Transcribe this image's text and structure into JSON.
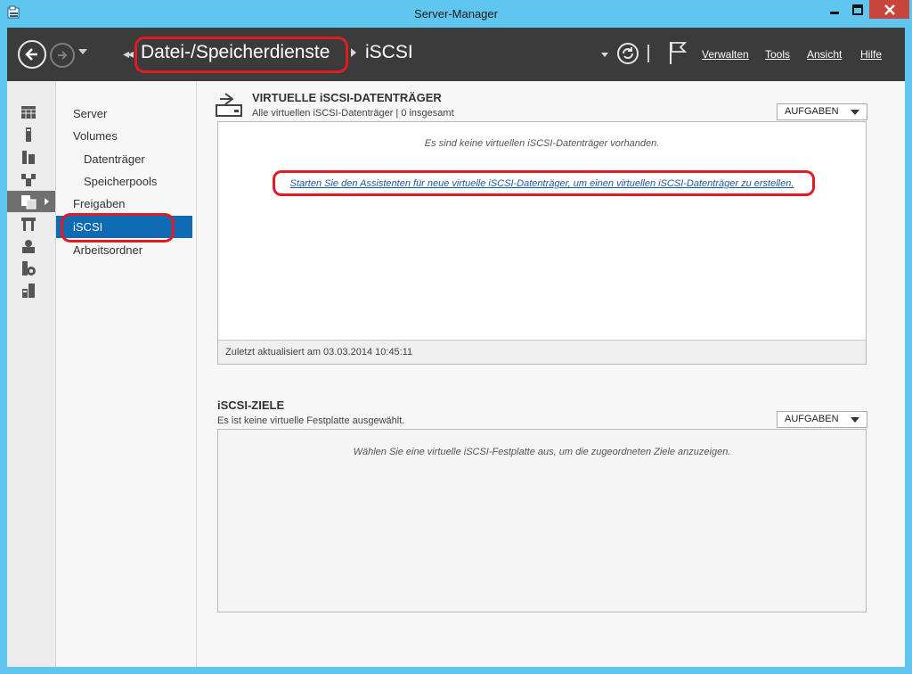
{
  "window": {
    "title": "Server-Manager"
  },
  "header": {
    "breadcrumb_main": "Datei-/Speicherdienste",
    "breadcrumb_sub": "iSCSI",
    "menu": [
      "Verwalten",
      "Tools",
      "Ansicht",
      "Hilfe"
    ]
  },
  "nav": {
    "items": [
      "Server",
      "Volumes",
      "Datenträger",
      "Speicherpools",
      "Freigaben",
      "iSCSI",
      "Arbeitsordner"
    ],
    "selected": "iSCSI"
  },
  "iscsi_disks": {
    "title": "VIRTUELLE iSCSI-DATENTRÄGER",
    "subtitle": "Alle virtuellen iSCSI-Datenträger | 0 insgesamt",
    "tasks": "AUFGABEN",
    "empty_message": "Es sind keine virtuellen iSCSI-Datenträger vorhanden.",
    "wizard_link": "Starten Sie den Assistenten für neue virtuelle iSCSI-Datenträger, um einen virtuellen iSCSI-Datenträger zu erstellen.",
    "footer": "Zuletzt aktualisiert am 03.03.2014 10:45:11"
  },
  "iscsi_targets": {
    "title": "iSCSI-ZIELE",
    "subtitle": "Es ist keine virtuelle Festplatte ausgewählt.",
    "tasks": "AUFGABEN",
    "empty_message": "Wählen Sie eine virtuelle iSCSI-Festplatte aus, um die zugeordneten Ziele anzuzeigen."
  },
  "colors": {
    "titlebar": "#5ec6ef",
    "header": "#3b3b3b",
    "selection": "#0f6ab4",
    "highlight": "#e21b22",
    "close": "#c7453a"
  }
}
